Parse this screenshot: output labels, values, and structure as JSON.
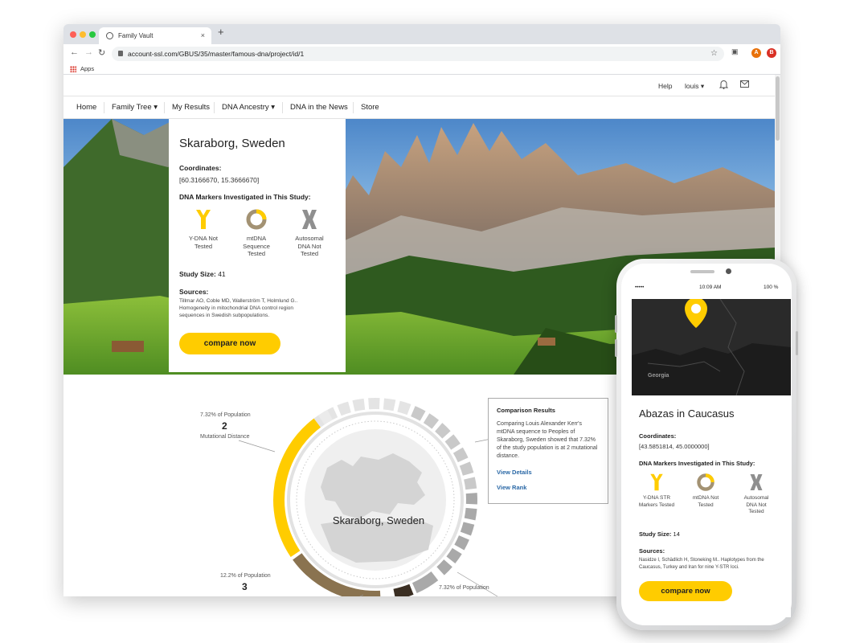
{
  "browser": {
    "tab_title": "Family Vault",
    "tab_close": "×",
    "new_tab": "+",
    "url": "account-ssl.com/GBUS/35/master/famous-dna/project/id/1",
    "bookmarks_apps": "Apps",
    "ext_badge_1": "A",
    "ext_badge_2": "B"
  },
  "utility_nav": {
    "help": "Help",
    "user": "louis ▾"
  },
  "main_nav": [
    {
      "label": "Home"
    },
    {
      "label": "Family Tree ▾"
    },
    {
      "label": "My Results"
    },
    {
      "label": "DNA Ancestry ▾"
    },
    {
      "label": "DNA in the News"
    },
    {
      "label": "Store"
    }
  ],
  "study_card": {
    "title": "Skaraborg, Sweden",
    "coordinates_label": "Coordinates:",
    "coordinates_value": "[60.3166670, 15.3666670]",
    "markers_label": "DNA Markers Investigated in This Study:",
    "markers": [
      {
        "line1": "Y-DNA Not",
        "line2": "Tested",
        "line3": ""
      },
      {
        "line1": "mtDNA",
        "line2": "Sequence",
        "line3": "Tested"
      },
      {
        "line1": "Autosomal",
        "line2": "DNA Not",
        "line3": "Tested"
      }
    ],
    "study_size_label": "Study Size:",
    "study_size_value": "41",
    "sources_label": "Sources:",
    "sources_text": "Tillmar AO, Coble MD, Wallerström T, Holmlund G.. Homogeneity in mitochondrial DNA control region sequences in Swedish subpopulations.",
    "button": "compare now"
  },
  "visualization": {
    "center_label": "Skaraborg, Sweden",
    "stat_top": {
      "pct": "7.32% of Population",
      "num": "2",
      "sub": "Mutational Distance"
    },
    "stat_bottom": {
      "pct": "12.2% of Population",
      "num": "3"
    },
    "stat_right": {
      "pct": "7.32% of Population"
    },
    "ring_shares": {
      "yellow": 0.0732,
      "brown": 0.122
    }
  },
  "comparison": {
    "title": "Comparison Results",
    "body": "Comparing Louis Alexander Kerr's mtDNA sequence to Peoples of Skaraborg, Sweden showed that 7.32% of the study population is at 2 mutational distance.",
    "link_details": "View Details",
    "link_rank": "View Rank"
  },
  "phone": {
    "status_time": "10:09 AM",
    "status_carrier": "•••••",
    "status_battery": "100 %",
    "map_label": "Georgia",
    "title": "Abazas in Caucasus",
    "coordinates_label": "Coordinates:",
    "coordinates_value": "[43.5851814, 45.0000000]",
    "markers_label": "DNA Markers Investigated in This Study:",
    "markers": [
      {
        "line1": "Y-DNA STR",
        "line2": "Markers Tested",
        "line3": ""
      },
      {
        "line1": "mtDNA Not",
        "line2": "Tested",
        "line3": ""
      },
      {
        "line1": "Autosomal",
        "line2": "DNA Not",
        "line3": "Tested"
      }
    ],
    "study_size_label": "Study Size:",
    "study_size_value": "14",
    "sources_label": "Sources:",
    "sources_text": "Nasidze I, Schädlich H, Stoneking M.. Haplotypes from the Caucasus, Turkey and Iran for nine Y-STR loci.",
    "button": "compare now"
  },
  "colors": {
    "accent_yellow": "#ffcc00",
    "brown": "#8a7350",
    "dark_brown": "#3a2e22",
    "link_blue": "#2a68a6"
  }
}
